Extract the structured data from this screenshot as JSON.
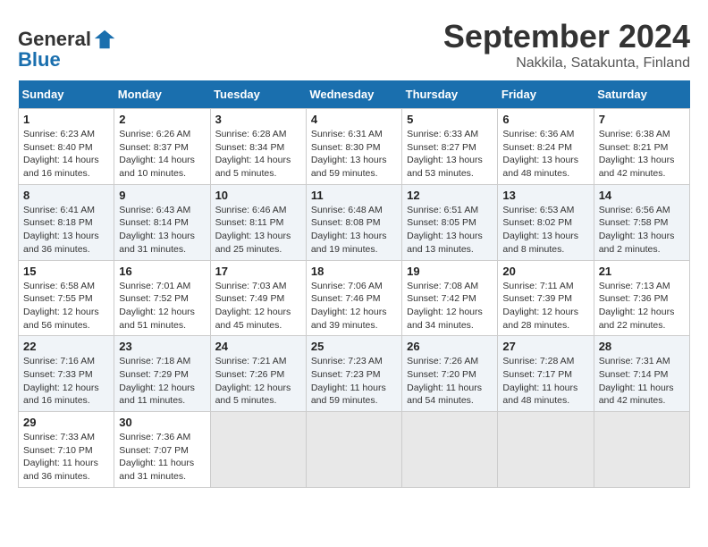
{
  "header": {
    "logo_line1": "General",
    "logo_line2": "Blue",
    "month": "September 2024",
    "location": "Nakkila, Satakunta, Finland"
  },
  "weekdays": [
    "Sunday",
    "Monday",
    "Tuesday",
    "Wednesday",
    "Thursday",
    "Friday",
    "Saturday"
  ],
  "weeks": [
    [
      {
        "day": "1",
        "info": "Sunrise: 6:23 AM\nSunset: 8:40 PM\nDaylight: 14 hours\nand 16 minutes."
      },
      {
        "day": "2",
        "info": "Sunrise: 6:26 AM\nSunset: 8:37 PM\nDaylight: 14 hours\nand 10 minutes."
      },
      {
        "day": "3",
        "info": "Sunrise: 6:28 AM\nSunset: 8:34 PM\nDaylight: 14 hours\nand 5 minutes."
      },
      {
        "day": "4",
        "info": "Sunrise: 6:31 AM\nSunset: 8:30 PM\nDaylight: 13 hours\nand 59 minutes."
      },
      {
        "day": "5",
        "info": "Sunrise: 6:33 AM\nSunset: 8:27 PM\nDaylight: 13 hours\nand 53 minutes."
      },
      {
        "day": "6",
        "info": "Sunrise: 6:36 AM\nSunset: 8:24 PM\nDaylight: 13 hours\nand 48 minutes."
      },
      {
        "day": "7",
        "info": "Sunrise: 6:38 AM\nSunset: 8:21 PM\nDaylight: 13 hours\nand 42 minutes."
      }
    ],
    [
      {
        "day": "8",
        "info": "Sunrise: 6:41 AM\nSunset: 8:18 PM\nDaylight: 13 hours\nand 36 minutes."
      },
      {
        "day": "9",
        "info": "Sunrise: 6:43 AM\nSunset: 8:14 PM\nDaylight: 13 hours\nand 31 minutes."
      },
      {
        "day": "10",
        "info": "Sunrise: 6:46 AM\nSunset: 8:11 PM\nDaylight: 13 hours\nand 25 minutes."
      },
      {
        "day": "11",
        "info": "Sunrise: 6:48 AM\nSunset: 8:08 PM\nDaylight: 13 hours\nand 19 minutes."
      },
      {
        "day": "12",
        "info": "Sunrise: 6:51 AM\nSunset: 8:05 PM\nDaylight: 13 hours\nand 13 minutes."
      },
      {
        "day": "13",
        "info": "Sunrise: 6:53 AM\nSunset: 8:02 PM\nDaylight: 13 hours\nand 8 minutes."
      },
      {
        "day": "14",
        "info": "Sunrise: 6:56 AM\nSunset: 7:58 PM\nDaylight: 13 hours\nand 2 minutes."
      }
    ],
    [
      {
        "day": "15",
        "info": "Sunrise: 6:58 AM\nSunset: 7:55 PM\nDaylight: 12 hours\nand 56 minutes."
      },
      {
        "day": "16",
        "info": "Sunrise: 7:01 AM\nSunset: 7:52 PM\nDaylight: 12 hours\nand 51 minutes."
      },
      {
        "day": "17",
        "info": "Sunrise: 7:03 AM\nSunset: 7:49 PM\nDaylight: 12 hours\nand 45 minutes."
      },
      {
        "day": "18",
        "info": "Sunrise: 7:06 AM\nSunset: 7:46 PM\nDaylight: 12 hours\nand 39 minutes."
      },
      {
        "day": "19",
        "info": "Sunrise: 7:08 AM\nSunset: 7:42 PM\nDaylight: 12 hours\nand 34 minutes."
      },
      {
        "day": "20",
        "info": "Sunrise: 7:11 AM\nSunset: 7:39 PM\nDaylight: 12 hours\nand 28 minutes."
      },
      {
        "day": "21",
        "info": "Sunrise: 7:13 AM\nSunset: 7:36 PM\nDaylight: 12 hours\nand 22 minutes."
      }
    ],
    [
      {
        "day": "22",
        "info": "Sunrise: 7:16 AM\nSunset: 7:33 PM\nDaylight: 12 hours\nand 16 minutes."
      },
      {
        "day": "23",
        "info": "Sunrise: 7:18 AM\nSunset: 7:29 PM\nDaylight: 12 hours\nand 11 minutes."
      },
      {
        "day": "24",
        "info": "Sunrise: 7:21 AM\nSunset: 7:26 PM\nDaylight: 12 hours\nand 5 minutes."
      },
      {
        "day": "25",
        "info": "Sunrise: 7:23 AM\nSunset: 7:23 PM\nDaylight: 11 hours\nand 59 minutes."
      },
      {
        "day": "26",
        "info": "Sunrise: 7:26 AM\nSunset: 7:20 PM\nDaylight: 11 hours\nand 54 minutes."
      },
      {
        "day": "27",
        "info": "Sunrise: 7:28 AM\nSunset: 7:17 PM\nDaylight: 11 hours\nand 48 minutes."
      },
      {
        "day": "28",
        "info": "Sunrise: 7:31 AM\nSunset: 7:14 PM\nDaylight: 11 hours\nand 42 minutes."
      }
    ],
    [
      {
        "day": "29",
        "info": "Sunrise: 7:33 AM\nSunset: 7:10 PM\nDaylight: 11 hours\nand 36 minutes."
      },
      {
        "day": "30",
        "info": "Sunrise: 7:36 AM\nSunset: 7:07 PM\nDaylight: 11 hours\nand 31 minutes."
      },
      {
        "day": "",
        "info": ""
      },
      {
        "day": "",
        "info": ""
      },
      {
        "day": "",
        "info": ""
      },
      {
        "day": "",
        "info": ""
      },
      {
        "day": "",
        "info": ""
      }
    ]
  ]
}
